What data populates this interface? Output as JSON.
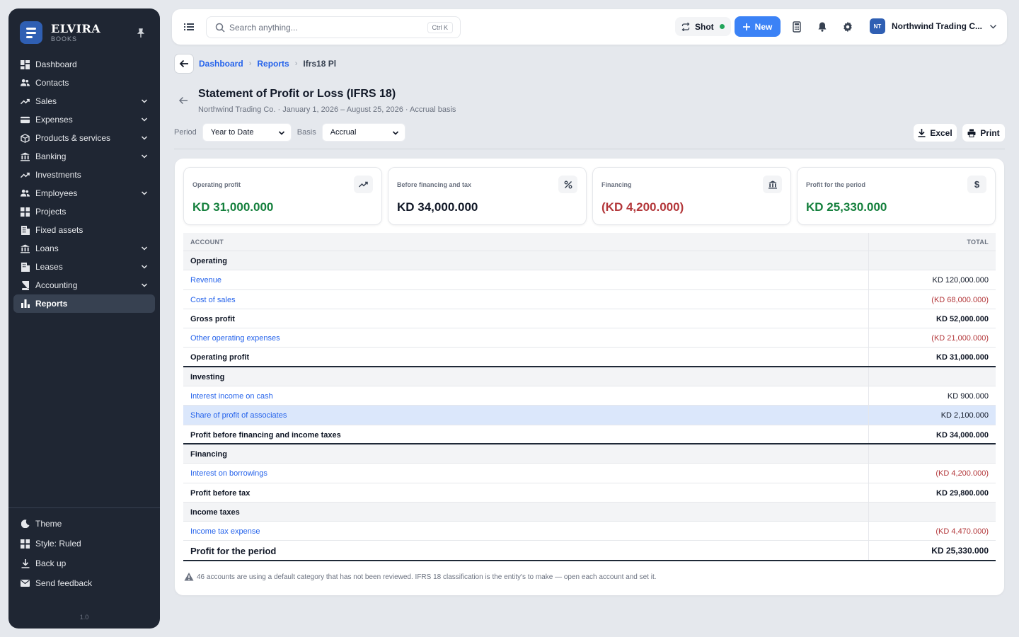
{
  "brand": {
    "name": "ELVIRA",
    "sub": "BOOKS"
  },
  "nav": {
    "dashboard": "Dashboard",
    "contacts": "Contacts",
    "sales": "Sales",
    "expenses": "Expenses",
    "products": "Products & services",
    "banking": "Banking",
    "investments": "Investments",
    "employees": "Employees",
    "projects": "Projects",
    "fixed_assets": "Fixed assets",
    "loans": "Loans",
    "leases": "Leases",
    "accounting": "Accounting",
    "reports": "Reports"
  },
  "footer_nav": {
    "theme": "Theme",
    "style": "Style: Ruled",
    "backup": "Back up",
    "feedback": "Send feedback",
    "version": "1.0"
  },
  "topbar": {
    "search_placeholder": "Search anything...",
    "search_shortcut": "Ctrl K",
    "shot_label": "Shot",
    "new_label": "New",
    "org_initials": "NT",
    "org_name": "Northwind Trading C..."
  },
  "breadcrumb": {
    "dashboard": "Dashboard",
    "reports": "Reports",
    "current": "Ifrs18 Pl"
  },
  "page": {
    "title": "Statement of Profit or Loss (IFRS 18)",
    "subtitle": "Northwind Trading Co. · January 1, 2026 – August 25, 2026 · Accrual basis"
  },
  "filters": {
    "period_label": "Period",
    "period_value": "Year to Date",
    "basis_label": "Basis",
    "basis_value": "Accrual",
    "excel_label": "Excel",
    "print_label": "Print"
  },
  "kpis": {
    "operating": {
      "label": "Operating profit",
      "value": "KD 31,000.000"
    },
    "before_financing": {
      "label": "Before financing and tax",
      "value": "KD 34,000.000"
    },
    "financing": {
      "label": "Financing",
      "value": "(KD 4,200.000)"
    },
    "profit_period": {
      "label": "Profit for the period",
      "value": "KD 25,330.000"
    }
  },
  "table": {
    "header_account": "ACCOUNT",
    "header_total": "TOTAL",
    "rows": {
      "operating": "Operating",
      "revenue": {
        "account": "Revenue",
        "total": "KD 120,000.000"
      },
      "cost_of_sales": {
        "account": "Cost of sales",
        "total": "(KD 68,000.000)"
      },
      "gross_profit": {
        "account": "Gross profit",
        "total": "KD 52,000.000"
      },
      "other_opex": {
        "account": "Other operating expenses",
        "total": "(KD 21,000.000)"
      },
      "operating_profit": {
        "account": "Operating profit",
        "total": "KD 31,000.000"
      },
      "investing": "Investing",
      "interest_income": {
        "account": "Interest income on cash",
        "total": "KD 900.000"
      },
      "share_associates": {
        "account": "Share of profit of associates",
        "total": "KD 2,100.000"
      },
      "profit_before_fin": {
        "account": "Profit before financing and income taxes",
        "total": "KD 34,000.000"
      },
      "financing": "Financing",
      "interest_borrowings": {
        "account": "Interest on borrowings",
        "total": "(KD 4,200.000)"
      },
      "profit_before_tax": {
        "account": "Profit before tax",
        "total": "KD 29,800.000"
      },
      "income_taxes": "Income taxes",
      "income_tax_expense": {
        "account": "Income tax expense",
        "total": "(KD 4,470.000)"
      },
      "profit_for_period": {
        "account": "Profit for the period",
        "total": "KD 25,330.000"
      }
    }
  },
  "note": "46 accounts are using a default category that has not been reviewed. IFRS 18 classification is the entity's to make — open each account and set it.",
  "colors": {
    "accent": "#3b82f6",
    "sidebar": "#1f2633",
    "positive": "#15803d",
    "negative": "#b3373a",
    "link": "#2563eb"
  }
}
